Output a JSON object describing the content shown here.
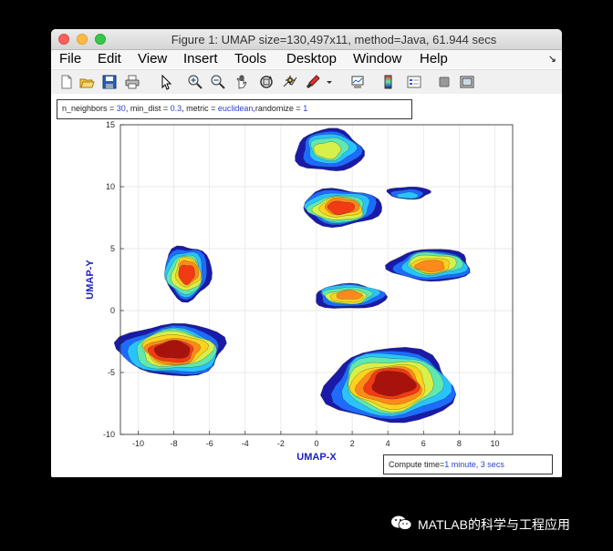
{
  "window": {
    "title": "Figure 1: UMAP size=130,497x11, method=Java, 61.944 secs"
  },
  "menu": {
    "items": [
      "File",
      "Edit",
      "View",
      "Insert",
      "Tools",
      "Desktop",
      "Window",
      "Help"
    ]
  },
  "toolbar": {
    "icons": [
      "new-figure-icon",
      "open-file-icon",
      "save-icon",
      "print-icon",
      "pointer-icon",
      "zoom-in-icon",
      "zoom-out-icon",
      "pan-icon",
      "rotate-icon",
      "data-cursor-icon",
      "brush-icon",
      "brush-dropdown-icon",
      "link-plot-icon",
      "colorbar-icon",
      "legend-icon",
      "hide-plot-tools-icon",
      "show-plot-tools-icon"
    ]
  },
  "params": {
    "nn_label": "n_neighbors = ",
    "nn_value": "30",
    "md_label": ", min_dist = ",
    "md_value": "0.3",
    "metric_label": ", metric = ",
    "metric_value": "euclidean",
    "rand_label": ",randomize = ",
    "rand_value": "1"
  },
  "compute": {
    "label": "Compute time=",
    "value": "1 minute, 3 secs"
  },
  "watermark": {
    "text": "MATLAB的科学与工程应用"
  },
  "chart_data": {
    "type": "heatmap",
    "xlabel": "UMAP-X",
    "ylabel": "UMAP-Y",
    "xlim": [
      -11,
      11
    ],
    "ylim": [
      -10,
      15
    ],
    "xticks": [
      -10,
      -8,
      -6,
      -4,
      -2,
      0,
      2,
      4,
      6,
      8,
      10
    ],
    "yticks": [
      -10,
      -5,
      0,
      5,
      10,
      15
    ],
    "grid": true,
    "colormap": [
      "#1a1aa8",
      "#1e6bff",
      "#29c4ff",
      "#5fe8b0",
      "#d8f04a",
      "#ffd21e",
      "#ff8a1a",
      "#f23a14",
      "#a8120c"
    ],
    "clusters": [
      {
        "cx": 0.7,
        "cy": 13.0,
        "rx": 1.9,
        "ry": 1.7,
        "peak": 0.55
      },
      {
        "cx": 1.3,
        "cy": 8.3,
        "rx": 2.2,
        "ry": 1.5,
        "peak": 0.85
      },
      {
        "cx": 5.2,
        "cy": 9.4,
        "rx": 1.2,
        "ry": 0.5,
        "peak": 0.3
      },
      {
        "cx": 6.5,
        "cy": 3.7,
        "rx": 2.3,
        "ry": 1.3,
        "peak": 0.8
      },
      {
        "cx": 1.8,
        "cy": 1.2,
        "rx": 2.0,
        "ry": 1.0,
        "peak": 0.75
      },
      {
        "cx": -7.3,
        "cy": 3.0,
        "rx": 1.3,
        "ry": 2.2,
        "peak": 0.9
      },
      {
        "cx": -8.0,
        "cy": -3.2,
        "rx": 3.0,
        "ry": 2.1,
        "peak": 1.0
      },
      {
        "cx": 4.2,
        "cy": -6.0,
        "rx": 3.6,
        "ry": 3.0,
        "peak": 0.95
      }
    ]
  }
}
